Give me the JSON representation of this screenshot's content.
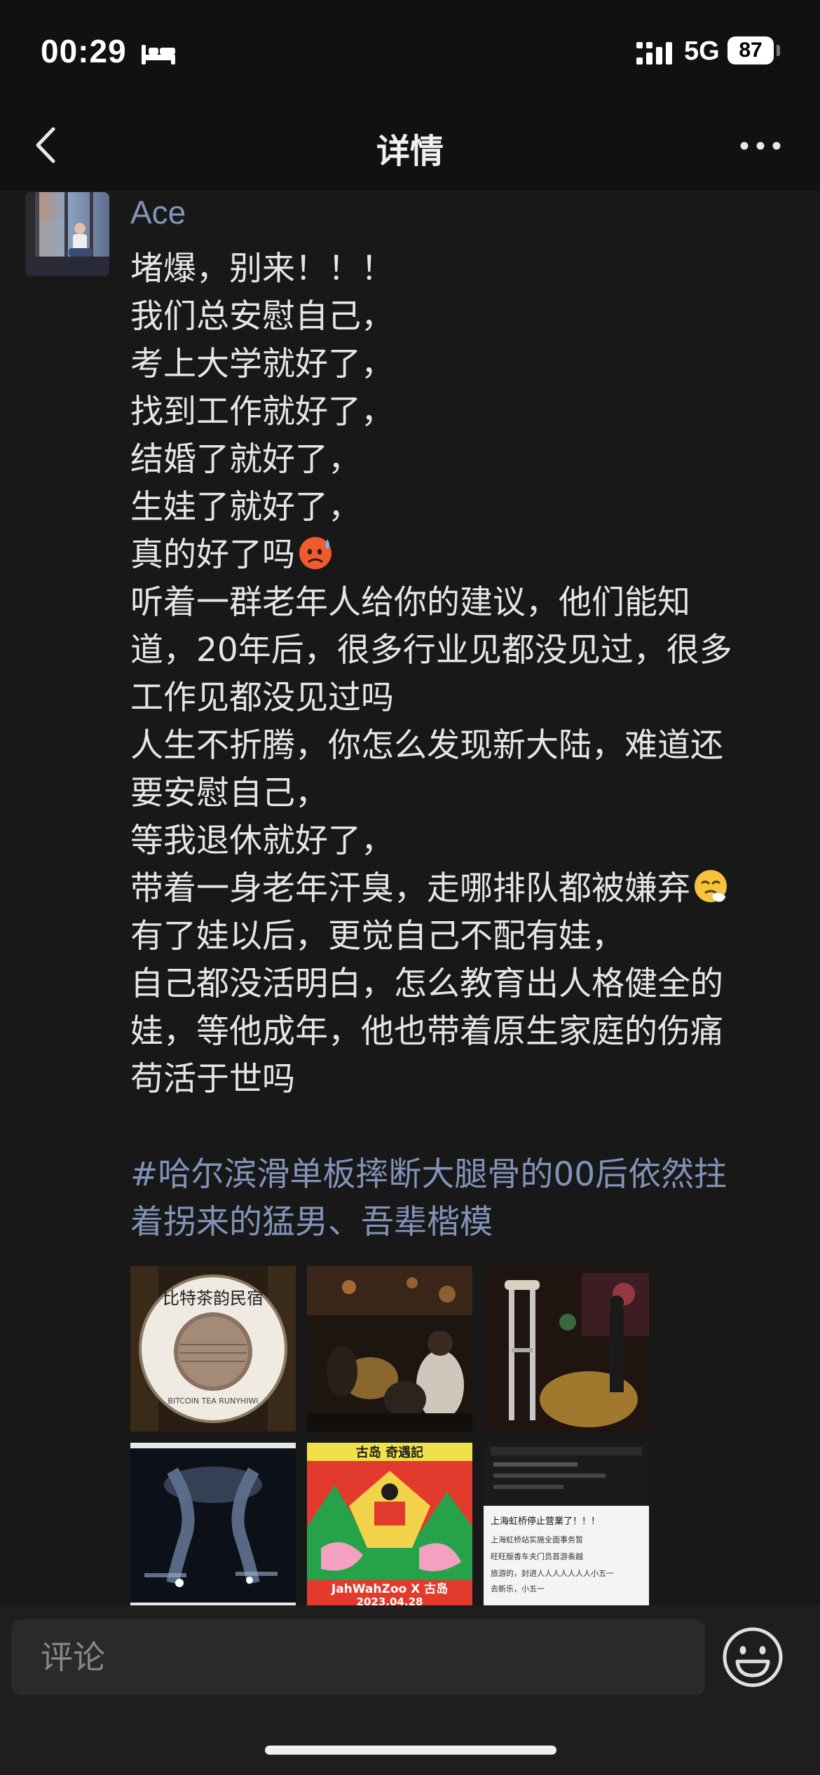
{
  "status_bar": {
    "time": "00:29",
    "network": "5G",
    "battery": "87"
  },
  "nav": {
    "title": "详情"
  },
  "post": {
    "author": "Ace",
    "lines": [
      "堵爆，别来！！！",
      "我们总安慰自己，",
      "考上大学就好了，",
      "找到工作就好了，",
      "结婚了就好了，",
      "生娃了就好了，",
      "真的好了吗",
      "听着一群老年人给你的建议，他们能知",
      "道，20年后，很多行业见都没见过，很多",
      "工作见都没见过吗",
      "人生不折腾，你怎么发现新大陆，难道还",
      "要安慰自己，",
      "等我退休就好了，",
      "带着一身老年汗臭，走哪排队都被嫌弃",
      "有了娃以后，更觉自己不配有娃，",
      "自己都没活明白，怎么教育出人格健全的",
      "娃，等他成年，他也带着原生家庭的伤痛",
      "苟活于世吗"
    ],
    "topic_lines": [
      "#哈尔滨滑单板摔断大腿骨的00后依然拄",
      "着拐来的猛男、吾辈楷模"
    ],
    "emoji_names": [
      "hot-face-emoji",
      "sneezing-face-emoji"
    ],
    "images": {
      "sign_text": "比特茶韵民宿",
      "sign_sub": "BITCOIN TEA RUNYHIWI",
      "poster_title": "JahWahZoo X 古岛",
      "poster_date": "2023.04.28",
      "poster_header": "古岛 奇遇記",
      "screenshot_lines": [
        "上海虹桥停止营業了！！！",
        "上海虹桥站实施全面事务暂",
        "旺旺版香车夫门员首游奏越",
        "旅游的，封进人人人人人人人小五一",
        "去新乐，小五一"
      ]
    }
  },
  "comment": {
    "placeholder": "评论"
  },
  "colors": {
    "background": "#181818",
    "link": "#8193b8",
    "text": "#e6e6e6"
  }
}
